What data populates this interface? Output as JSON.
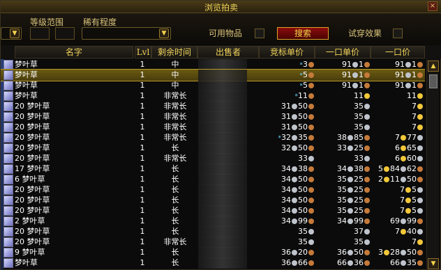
{
  "window": {
    "title": "浏览拍卖",
    "close_glyph": "×"
  },
  "filters": {
    "level_range_label": "等级范围",
    "rarity_label": "稀有程度",
    "usable_items_label": "可用物品",
    "search_button": "搜索",
    "try_on_label": "试穿效果"
  },
  "columns": {
    "name": "名字",
    "lvl": "Lvl",
    "time_left": "剩余时间",
    "seller": "出售者",
    "bid_unit_price": "竞标单价",
    "buyout_unit_price": "一口单价",
    "buyout_price": "一口价"
  },
  "rows": [
    {
      "name": "梦叶草",
      "lvl": "1",
      "time": "中",
      "bid": [
        {
          "n": "*3",
          "t": "c"
        }
      ],
      "unit": [
        {
          "n": "91",
          "t": "s"
        },
        {
          "n": "1",
          "t": "c"
        }
      ],
      "bo": [
        {
          "n": "91",
          "t": "s"
        },
        {
          "n": "1",
          "t": "c"
        }
      ]
    },
    {
      "name": "梦叶草",
      "lvl": "1",
      "time": "中",
      "bid": [
        {
          "n": "*5",
          "t": "c"
        }
      ],
      "unit": [
        {
          "n": "91",
          "t": "s"
        },
        {
          "n": "1",
          "t": "c"
        }
      ],
      "bo": [
        {
          "n": "91",
          "t": "s"
        },
        {
          "n": "1",
          "t": "c"
        }
      ],
      "selected": true
    },
    {
      "name": "梦叶草",
      "lvl": "1",
      "time": "中",
      "bid": [
        {
          "n": "*5",
          "t": "c"
        }
      ],
      "unit": [
        {
          "n": "91",
          "t": "s"
        },
        {
          "n": "1",
          "t": "c"
        }
      ],
      "bo": [
        {
          "n": "91",
          "t": "s"
        },
        {
          "n": "1",
          "t": "c"
        }
      ]
    },
    {
      "name": "梦叶草",
      "lvl": "1",
      "time": "非常长",
      "bid": [
        {
          "n": "*11",
          "t": "c"
        }
      ],
      "unit": [
        {
          "n": "11",
          "t": "g"
        }
      ],
      "bo": [
        {
          "n": "11",
          "t": "g"
        }
      ]
    },
    {
      "name": "20 梦叶草",
      "lvl": "1",
      "time": "非常长",
      "bid": [
        {
          "n": "31",
          "t": "s"
        },
        {
          "n": "50",
          "t": "c"
        }
      ],
      "unit": [
        {
          "n": "35",
          "t": "s"
        }
      ],
      "bo": [
        {
          "n": "7",
          "t": "g"
        }
      ]
    },
    {
      "name": "20 梦叶草",
      "lvl": "1",
      "time": "非常长",
      "bid": [
        {
          "n": "31",
          "t": "s"
        },
        {
          "n": "50",
          "t": "c"
        }
      ],
      "unit": [
        {
          "n": "35",
          "t": "s"
        }
      ],
      "bo": [
        {
          "n": "7",
          "t": "g"
        }
      ]
    },
    {
      "name": "20 梦叶草",
      "lvl": "1",
      "time": "非常长",
      "bid": [
        {
          "n": "31",
          "t": "s"
        },
        {
          "n": "50",
          "t": "c"
        }
      ],
      "unit": [
        {
          "n": "35",
          "t": "s"
        }
      ],
      "bo": [
        {
          "n": "7",
          "t": "g"
        }
      ]
    },
    {
      "name": "20 梦叶草",
      "lvl": "1",
      "time": "非常长",
      "bid": [
        {
          "n": "*32",
          "t": "s"
        },
        {
          "n": "35",
          "t": "c"
        }
      ],
      "unit": [
        {
          "n": "38",
          "t": "s"
        },
        {
          "n": "85",
          "t": "c"
        }
      ],
      "bo": [
        {
          "n": "7",
          "t": "g"
        },
        {
          "n": "77",
          "t": "s"
        }
      ]
    },
    {
      "name": "20 梦叶草",
      "lvl": "1",
      "time": "长",
      "bid": [
        {
          "n": "32",
          "t": "s"
        },
        {
          "n": "50",
          "t": "c"
        }
      ],
      "unit": [
        {
          "n": "33",
          "t": "s"
        },
        {
          "n": "25",
          "t": "c"
        }
      ],
      "bo": [
        {
          "n": "6",
          "t": "g"
        },
        {
          "n": "65",
          "t": "s"
        }
      ]
    },
    {
      "name": "20 梦叶草",
      "lvl": "1",
      "time": "非常长",
      "bid": [
        {
          "n": "33",
          "t": "s"
        }
      ],
      "unit": [
        {
          "n": "33",
          "t": "s"
        }
      ],
      "bo": [
        {
          "n": "6",
          "t": "g"
        },
        {
          "n": "60",
          "t": "s"
        }
      ]
    },
    {
      "name": "17 梦叶草",
      "lvl": "1",
      "time": "长",
      "bid": [
        {
          "n": "34",
          "t": "s"
        },
        {
          "n": "38",
          "t": "c"
        }
      ],
      "unit": [
        {
          "n": "34",
          "t": "s"
        },
        {
          "n": "38",
          "t": "c"
        }
      ],
      "bo": [
        {
          "n": "5",
          "t": "g"
        },
        {
          "n": "84",
          "t": "s"
        },
        {
          "n": "62",
          "t": "c"
        }
      ]
    },
    {
      "name": "6 梦叶草",
      "lvl": "1",
      "time": "长",
      "bid": [
        {
          "n": "34",
          "t": "s"
        },
        {
          "n": "50",
          "t": "c"
        }
      ],
      "unit": [
        {
          "n": "35",
          "t": "s"
        },
        {
          "n": "25",
          "t": "c"
        }
      ],
      "bo": [
        {
          "n": "2",
          "t": "g"
        },
        {
          "n": "11",
          "t": "s"
        },
        {
          "n": "50",
          "t": "c"
        }
      ]
    },
    {
      "name": "20 梦叶草",
      "lvl": "1",
      "time": "长",
      "bid": [
        {
          "n": "34",
          "t": "s"
        },
        {
          "n": "50",
          "t": "c"
        }
      ],
      "unit": [
        {
          "n": "35",
          "t": "s"
        },
        {
          "n": "25",
          "t": "c"
        }
      ],
      "bo": [
        {
          "n": "7",
          "t": "g"
        },
        {
          "n": "5",
          "t": "s"
        }
      ]
    },
    {
      "name": "20 梦叶草",
      "lvl": "1",
      "time": "长",
      "bid": [
        {
          "n": "34",
          "t": "s"
        },
        {
          "n": "50",
          "t": "c"
        }
      ],
      "unit": [
        {
          "n": "35",
          "t": "s"
        },
        {
          "n": "25",
          "t": "c"
        }
      ],
      "bo": [
        {
          "n": "7",
          "t": "g"
        },
        {
          "n": "5",
          "t": "s"
        }
      ]
    },
    {
      "name": "20 梦叶草",
      "lvl": "1",
      "time": "长",
      "bid": [
        {
          "n": "34",
          "t": "s"
        },
        {
          "n": "50",
          "t": "c"
        }
      ],
      "unit": [
        {
          "n": "35",
          "t": "s"
        },
        {
          "n": "25",
          "t": "c"
        }
      ],
      "bo": [
        {
          "n": "7",
          "t": "g"
        },
        {
          "n": "5",
          "t": "s"
        }
      ]
    },
    {
      "name": "2 梦叶草",
      "lvl": "1",
      "time": "长",
      "bid": [
        {
          "n": "34",
          "t": "s"
        },
        {
          "n": "99",
          "t": "c"
        }
      ],
      "unit": [
        {
          "n": "34",
          "t": "s"
        },
        {
          "n": "99",
          "t": "c"
        }
      ],
      "bo": [
        {
          "n": "69",
          "t": "s"
        },
        {
          "n": "99",
          "t": "c"
        }
      ]
    },
    {
      "name": "20 梦叶草",
      "lvl": "1",
      "time": "长",
      "bid": [
        {
          "n": "35",
          "t": "s"
        }
      ],
      "unit": [
        {
          "n": "37",
          "t": "s"
        }
      ],
      "bo": [
        {
          "n": "7",
          "t": "g"
        },
        {
          "n": "40",
          "t": "s"
        }
      ]
    },
    {
      "name": "20 梦叶草",
      "lvl": "1",
      "time": "非常长",
      "bid": [
        {
          "n": "35",
          "t": "s"
        }
      ],
      "unit": [
        {
          "n": "35",
          "t": "s"
        }
      ],
      "bo": [
        {
          "n": "7",
          "t": "g"
        }
      ]
    },
    {
      "name": "9 梦叶草",
      "lvl": "1",
      "time": "长",
      "bid": [
        {
          "n": "36",
          "t": "s"
        },
        {
          "n": "20",
          "t": "c"
        }
      ],
      "unit": [
        {
          "n": "36",
          "t": "s"
        },
        {
          "n": "50",
          "t": "c"
        }
      ],
      "bo": [
        {
          "n": "3",
          "t": "g"
        },
        {
          "n": "28",
          "t": "s"
        },
        {
          "n": "50",
          "t": "c"
        }
      ]
    },
    {
      "name": "梦叶草",
      "lvl": "1",
      "time": "长",
      "bid": [
        {
          "n": "36",
          "t": "s"
        },
        {
          "n": "66",
          "t": "c"
        }
      ],
      "unit": [
        {
          "n": "66",
          "t": "s"
        },
        {
          "n": "36",
          "t": "c"
        }
      ],
      "bo": [
        {
          "n": "66",
          "t": "s"
        },
        {
          "n": "35",
          "t": "c"
        }
      ]
    }
  ]
}
